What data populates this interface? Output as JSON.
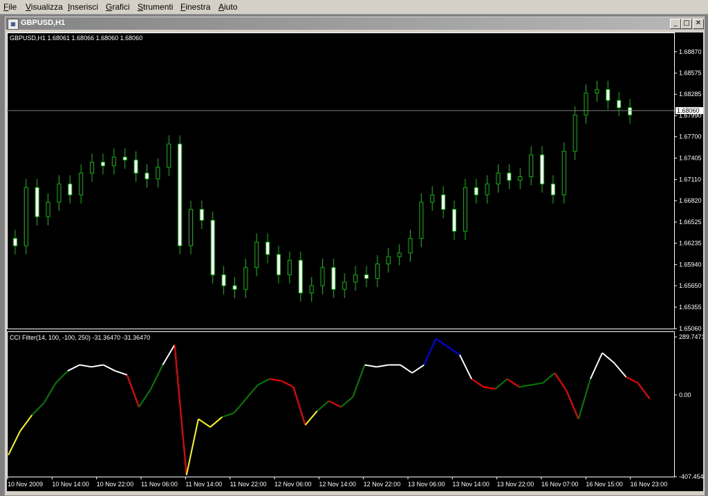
{
  "menu": [
    "File",
    "Visualizza",
    "Inserisci",
    "Grafici",
    "Strumenti",
    "Finestra",
    "Aiuto"
  ],
  "window": {
    "title": "GBPUSD,H1",
    "minimize": "_",
    "restore": "□",
    "close": "✕"
  },
  "price_panel": {
    "header": "GBPUSD,H1  1.68061 1.68066 1.68060 1.68060",
    "current_price": "1.68060",
    "y_ticks": [
      "1.68870",
      "1.68575",
      "1.68285",
      "1.67990",
      "1.67700",
      "1.67405",
      "1.67110",
      "1.66820",
      "1.66525",
      "1.66235",
      "1.65940",
      "1.65650",
      "1.65355",
      "1.65060"
    ]
  },
  "indicator_panel": {
    "header": "CCI Filter(14, 100, -100, 250) -31.36470 -31.36470",
    "y_ticks": [
      "289.7471",
      "0.00",
      "-407.454"
    ]
  },
  "x_ticks": [
    "10 Nov 2009",
    "10 Nov 14:00",
    "10 Nov 22:00",
    "11 Nov 06:00",
    "11 Nov 14:00",
    "11 Nov 22:00",
    "12 Nov 06:00",
    "12 Nov 14:00",
    "12 Nov 22:00",
    "13 Nov 06:00",
    "13 Nov 14:00",
    "13 Nov 22:00",
    "16 Nov 07:00",
    "16 Nov 15:00",
    "16 Nov 23:00"
  ],
  "colors": {
    "background": "#000000",
    "candle": "#00c000",
    "bull_body": "#000000",
    "bear_body": "#ffffff",
    "cci_white": "#ffffff",
    "cci_red": "#ff0000",
    "cci_blue": "#0000ff",
    "cci_yellow": "#ffff00",
    "cci_green": "#008000"
  },
  "chart_data": [
    {
      "type": "candlestick",
      "title": "GBPUSD,H1",
      "ylim": [
        1.6506,
        1.6902
      ],
      "x_tick_labels": [
        "10 Nov 2009",
        "10 Nov 14:00",
        "10 Nov 22:00",
        "11 Nov 06:00",
        "11 Nov 14:00",
        "11 Nov 22:00",
        "12 Nov 06:00",
        "12 Nov 14:00",
        "12 Nov 22:00",
        "13 Nov 06:00",
        "13 Nov 14:00",
        "13 Nov 22:00",
        "16 Nov 07:00",
        "16 Nov 15:00",
        "16 Nov 23:00"
      ],
      "close": [
        1.662,
        1.67,
        1.666,
        1.668,
        1.6705,
        1.669,
        1.672,
        1.6735,
        1.673,
        1.6742,
        1.6738,
        1.672,
        1.6712,
        1.6728,
        1.676,
        1.662,
        1.667,
        1.6655,
        1.658,
        1.6565,
        1.656,
        1.659,
        1.6625,
        1.6608,
        1.658,
        1.66,
        1.6555,
        1.6565,
        1.659,
        1.656,
        1.657,
        1.658,
        1.6575,
        1.6595,
        1.6605,
        1.661,
        1.663,
        1.668,
        1.669,
        1.667,
        1.664,
        1.67,
        1.669,
        1.6705,
        1.672,
        1.671,
        1.6715,
        1.6745,
        1.6705,
        1.669,
        1.675,
        1.68,
        1.683,
        1.6835,
        1.682,
        1.681,
        1.68
      ]
    },
    {
      "type": "line",
      "title": "CCI Filter(14, 100, -100, 250) -31.36470 -31.36470",
      "ylim": [
        -407.454,
        289.7471
      ],
      "values": [
        -300,
        -180,
        -100,
        -40,
        60,
        120,
        150,
        140,
        150,
        120,
        100,
        -60,
        30,
        150,
        250,
        -400,
        -120,
        -160,
        -110,
        -90,
        -20,
        50,
        80,
        70,
        40,
        -150,
        -80,
        -30,
        -60,
        -10,
        150,
        140,
        150,
        150,
        110,
        150,
        280,
        240,
        200,
        80,
        40,
        30,
        80,
        40,
        50,
        60,
        110,
        20,
        -120,
        80,
        210,
        160,
        90,
        60,
        -20
      ]
    }
  ]
}
